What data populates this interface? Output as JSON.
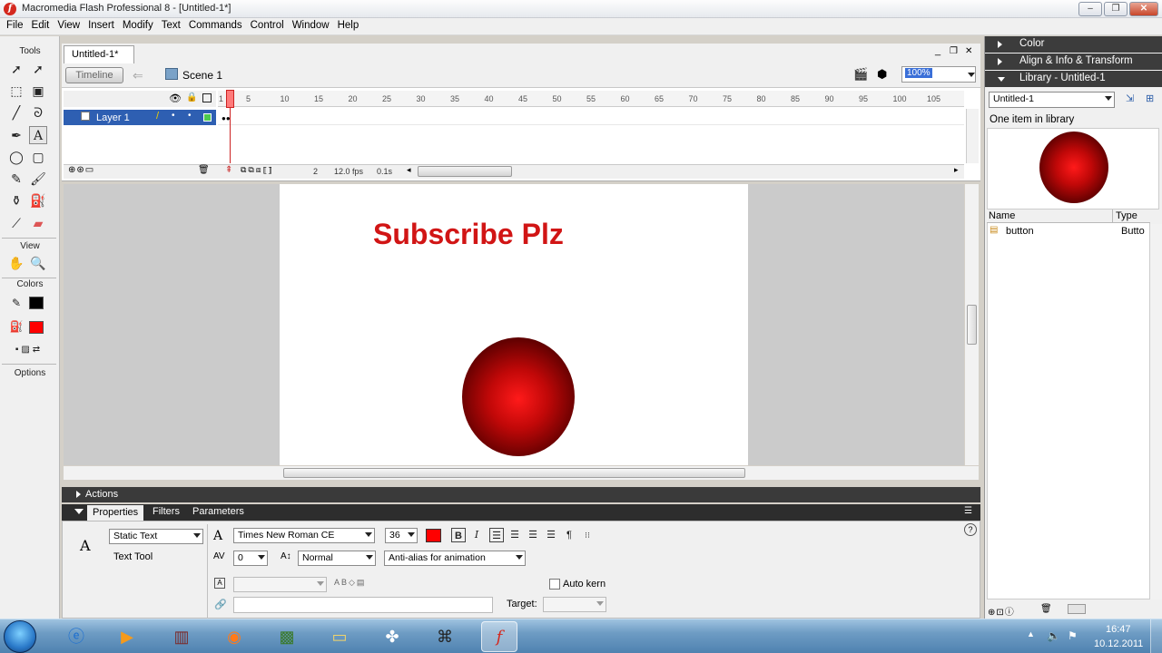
{
  "window": {
    "title": "Macromedia Flash Professional 8 - [Untitled-1*]",
    "app_icon_glyph": "f",
    "minimize_glyph": "–",
    "restore_glyph": "❐",
    "close_glyph": "✕"
  },
  "menu": [
    "File",
    "Edit",
    "View",
    "Insert",
    "Modify",
    "Text",
    "Commands",
    "Control",
    "Window",
    "Help"
  ],
  "tools": {
    "title": "Tools",
    "view_label": "View",
    "colors_label": "Colors",
    "options_label": "Options",
    "stroke_color": "#000000",
    "fill_color": "#ff0000"
  },
  "document": {
    "tab_label": "Untitled-1*",
    "timeline_button": "Timeline",
    "scene_label": "Scene 1",
    "zoom": "100%",
    "doc_minimize": "_",
    "doc_restore": "❐",
    "doc_close": "✕"
  },
  "timeline": {
    "ruler_ticks": [
      "1",
      "5",
      "10",
      "15",
      "20",
      "25",
      "30",
      "35",
      "40",
      "45",
      "50",
      "55",
      "60",
      "65",
      "70",
      "75",
      "80",
      "85",
      "90",
      "95",
      "100",
      "105"
    ],
    "layer_name": "Layer 1",
    "current_frame": "2",
    "frame_rate": "12.0 fps",
    "elapsed": "0.1s"
  },
  "stage": {
    "text": "Subscribe Plz",
    "text_color": "#d11515"
  },
  "panels": {
    "actions_label": "Actions",
    "tabs": [
      "Properties",
      "Filters",
      "Parameters"
    ],
    "text_type": "Static Text",
    "tool_label": "Text Tool",
    "font": "Times New Roman CE",
    "font_size": "36",
    "text_color": "#ff0000",
    "letter_spacing": "0",
    "char_position": "Normal",
    "anti_alias": "Anti-alias for animation",
    "auto_kern_label": "Auto kern",
    "target_label": "Target:"
  },
  "right_panels": {
    "color_label": "Color",
    "align_label": "Align & Info & Transform",
    "library_label": "Library - Untitled-1",
    "library_select": "Untitled-1",
    "item_count": "One item in library",
    "col_name": "Name",
    "col_type": "Type",
    "items": [
      {
        "name": "button",
        "type": "Butto"
      }
    ]
  },
  "taskbar": {
    "time": "16:47",
    "date": "10.12.2011"
  }
}
